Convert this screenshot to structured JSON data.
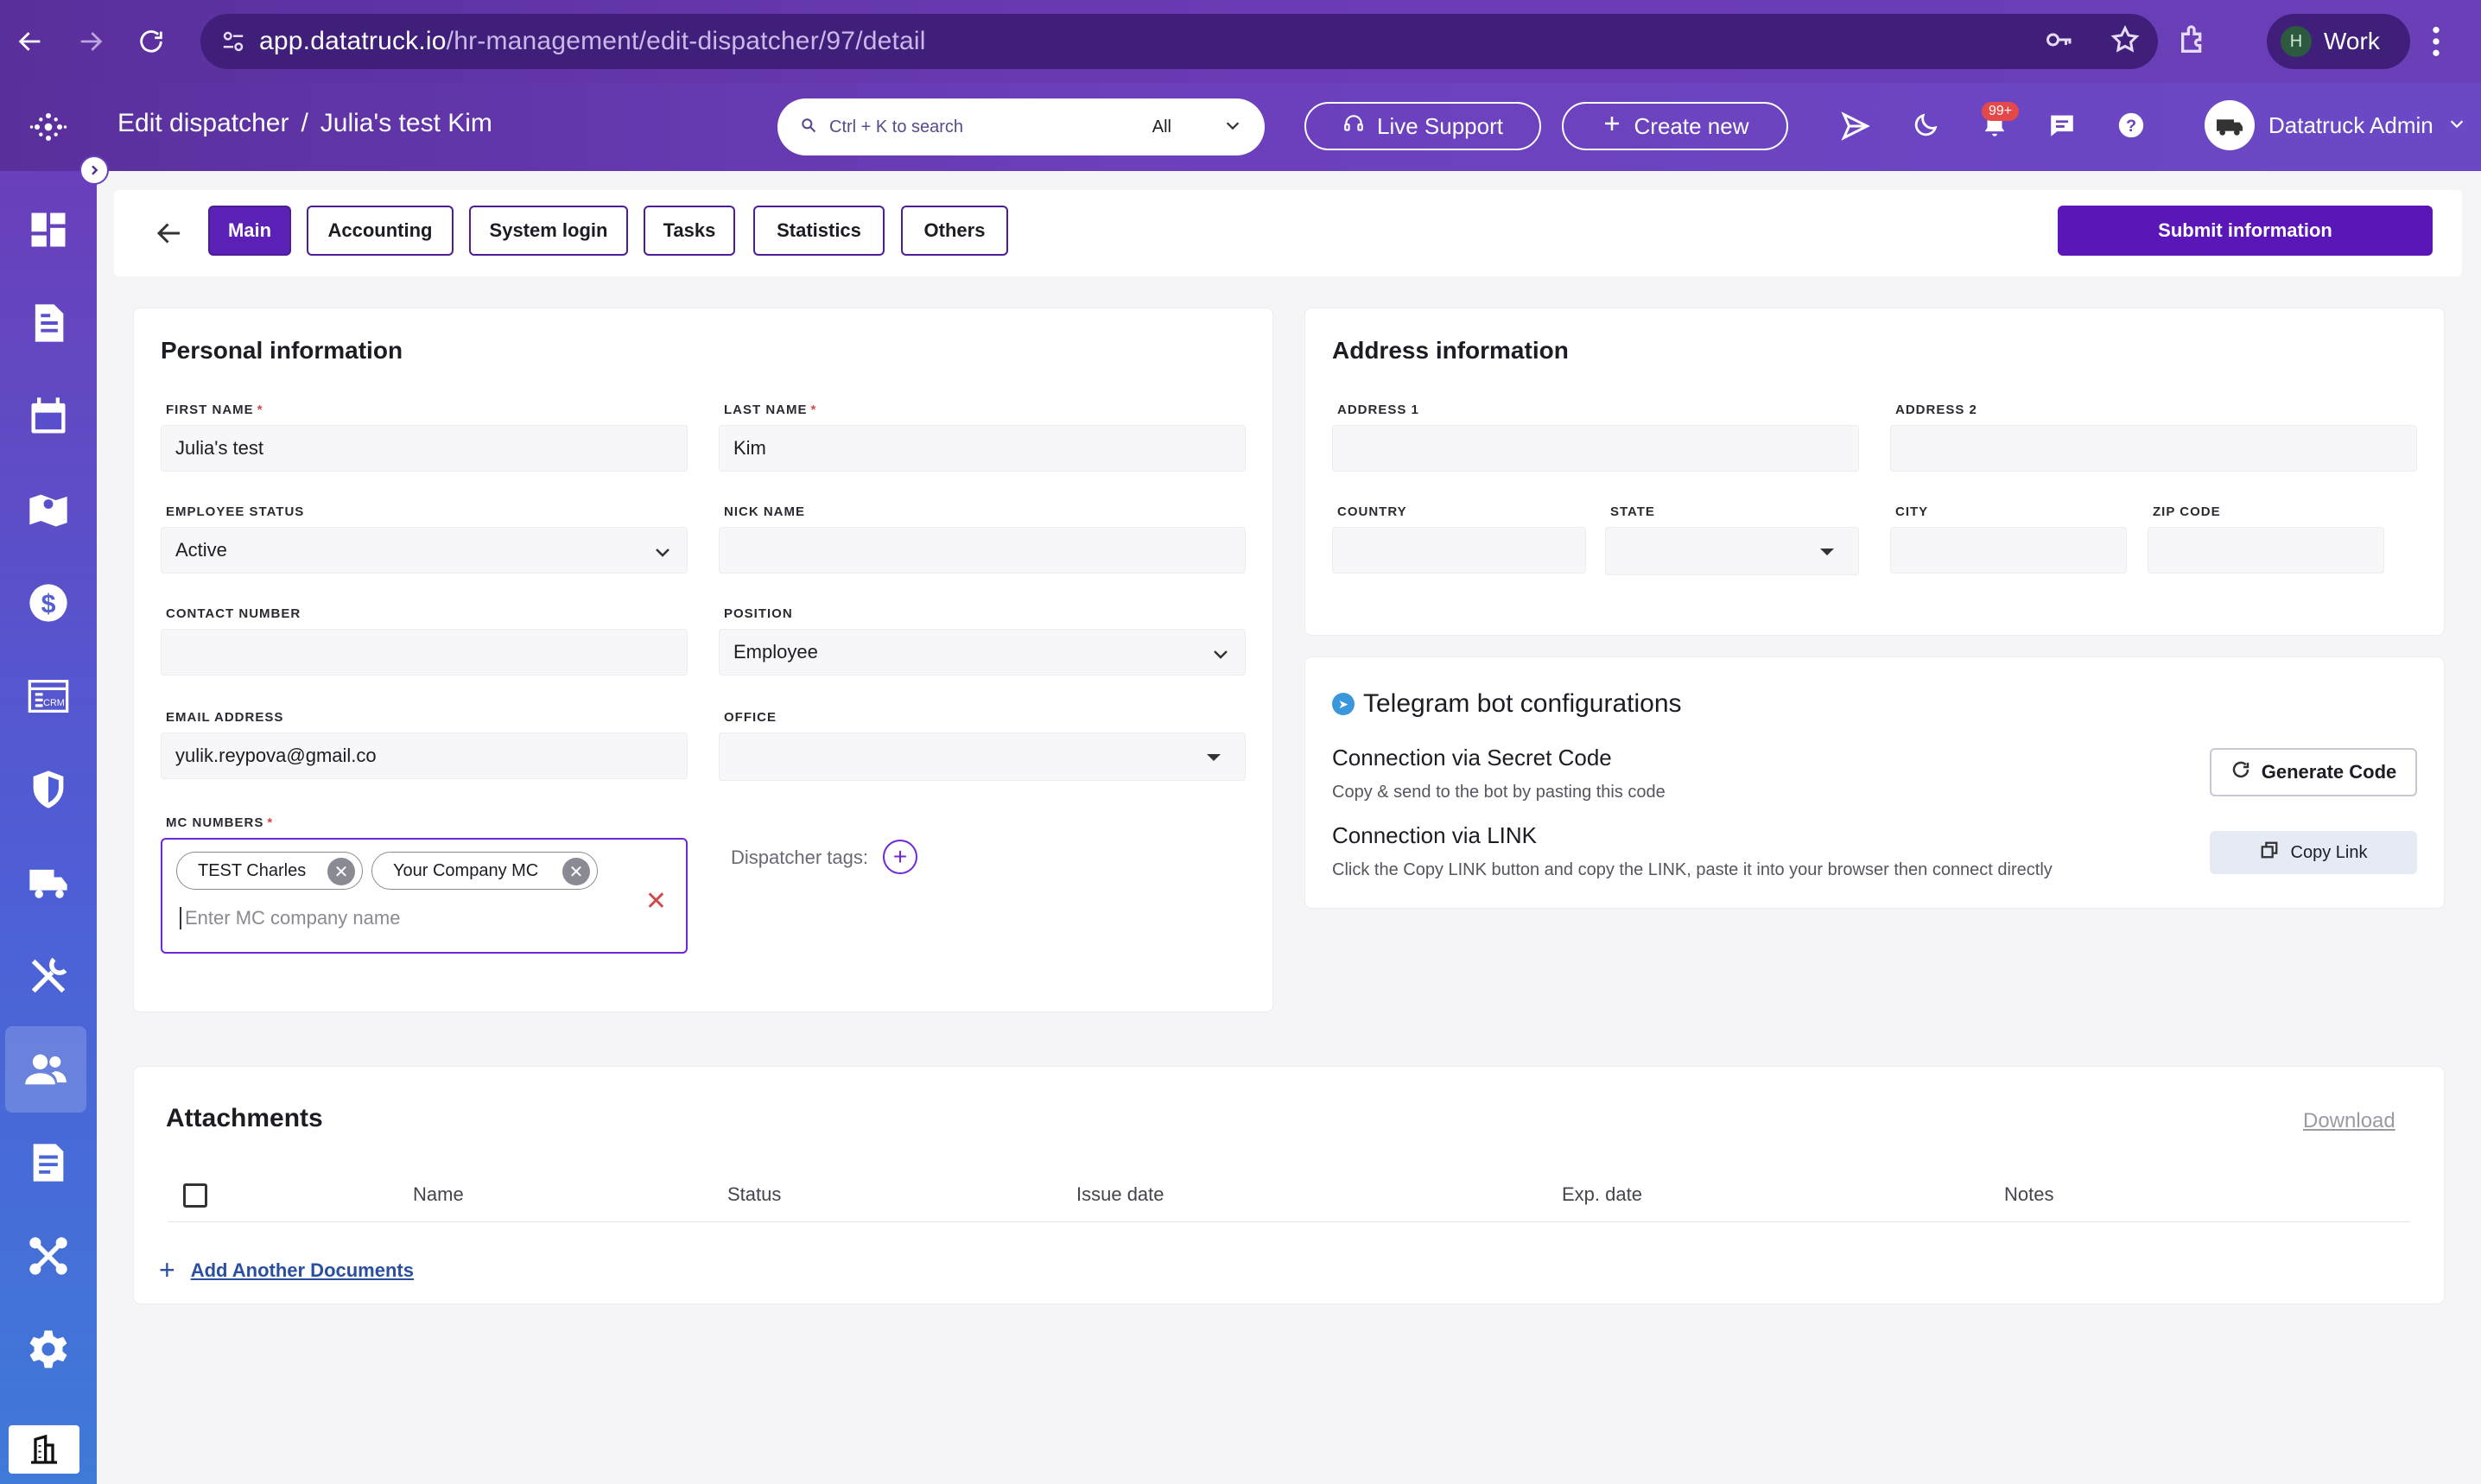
{
  "browser": {
    "url_host": "app.datatruck.io",
    "url_path": "/hr-management/edit-dispatcher/97/detail",
    "profile_initial": "H",
    "profile_name": "Work"
  },
  "header": {
    "breadcrumb_section": "Edit dispatcher",
    "breadcrumb_separator": "/",
    "breadcrumb_item": "Julia's test Kim",
    "search_placeholder": "Ctrl + K to search",
    "search_scope": "All",
    "live_support": "Live Support",
    "create_new": "Create new",
    "notification_count": "99+",
    "admin_name": "Datatruck Admin"
  },
  "sidebar": {
    "items": [
      "dashboard-icon",
      "document-icon",
      "calendar-icon",
      "map-icon",
      "dollar-icon",
      "crm-icon",
      "shield-icon",
      "truck-icon",
      "tools-icon",
      "users-icon",
      "report-icon",
      "integration-icon",
      "settings-icon"
    ],
    "crm_text": "CRM"
  },
  "tabs": {
    "items": [
      "Main",
      "Accounting",
      "System login",
      "Tasks",
      "Statistics",
      "Others"
    ],
    "active": "Main",
    "submit_label": "Submit information"
  },
  "personal": {
    "title": "Personal information",
    "first_name_label": "FIRST NAME",
    "first_name": "Julia's test",
    "last_name_label": "LAST NAME",
    "last_name": "Kim",
    "employee_status_label": "EMPLOYEE STATUS",
    "employee_status": "Active",
    "nick_name_label": "NICK NAME",
    "nick_name": "",
    "contact_label": "CONTACT NUMBER",
    "contact": "",
    "position_label": "POSITION",
    "position": "Employee",
    "email_label": "EMAIL ADDRESS",
    "email": "yulik.reypova@gmail.co",
    "office_label": "OFFICE",
    "office": "",
    "mc_label": "MC NUMBERS",
    "mc_chips": [
      "TEST Charles",
      "Your Company MC"
    ],
    "mc_placeholder": "Enter MC company name",
    "tags_label": "Dispatcher tags:",
    "required_mark": "*"
  },
  "address": {
    "title": "Address information",
    "address1_label": "ADDRESS 1",
    "address2_label": "ADDRESS 2",
    "country_label": "COUNTRY",
    "state_label": "STATE",
    "city_label": "CITY",
    "zip_label": "ZIP CODE"
  },
  "telegram": {
    "title": "Telegram bot configurations",
    "secret_title": "Connection via Secret Code",
    "secret_desc": "Copy & send to the bot by pasting this code",
    "link_title": "Connection via LINK",
    "link_desc": "Click the Copy LINK button and copy the LINK, paste it into your browser then connect directly",
    "generate_label": "Generate Code",
    "copy_label": "Copy Link"
  },
  "attachments": {
    "title": "Attachments",
    "download_label": "Download",
    "columns": [
      "Name",
      "Status",
      "Issue date",
      "Exp. date",
      "Notes"
    ],
    "add_label": "Add Another Documents"
  }
}
